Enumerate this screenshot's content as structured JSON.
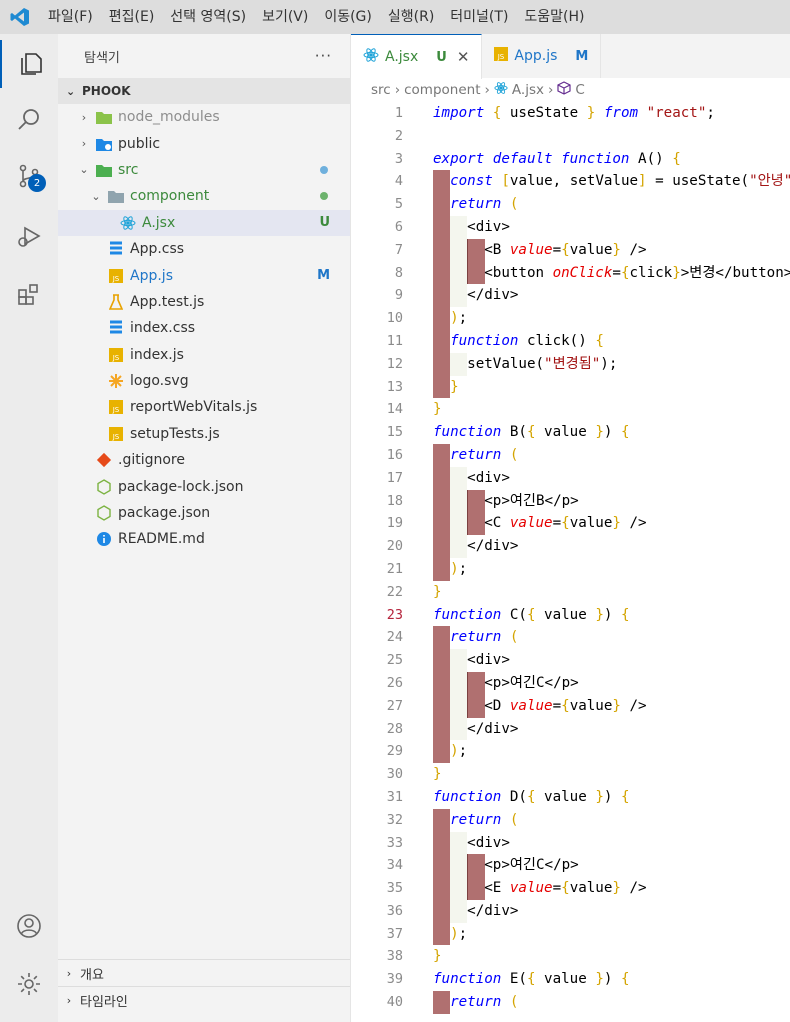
{
  "menu": [
    "파일(F)",
    "편집(E)",
    "선택 영역(S)",
    "보기(V)",
    "이동(G)",
    "실행(R)",
    "터미널(T)",
    "도움말(H)"
  ],
  "sidebar": {
    "title": "탐색기",
    "more": "···",
    "section": "PHOOK",
    "scm_badge": "2",
    "tree": [
      {
        "label": "node_modules",
        "chev": "›",
        "icon": "folder-node",
        "depth": 0,
        "style": "dim"
      },
      {
        "label": "public",
        "chev": "›",
        "icon": "folder-public",
        "depth": 0
      },
      {
        "label": "src",
        "chev": "⌄",
        "icon": "folder-src",
        "depth": 0,
        "style": "new",
        "dot": "#6fb0dd"
      },
      {
        "label": "component",
        "chev": "⌄",
        "icon": "folder-open",
        "depth": 1,
        "style": "new",
        "dot": "#6db36d"
      },
      {
        "label": "A.jsx",
        "icon": "react",
        "depth": 2,
        "style": "new",
        "status": "U",
        "selected": true
      },
      {
        "label": "App.css",
        "icon": "css",
        "depth": 1
      },
      {
        "label": "App.js",
        "icon": "js",
        "depth": 1,
        "style": "mod",
        "status": "M"
      },
      {
        "label": "App.test.js",
        "icon": "test",
        "depth": 1
      },
      {
        "label": "index.css",
        "icon": "css",
        "depth": 1
      },
      {
        "label": "index.js",
        "icon": "js",
        "depth": 1
      },
      {
        "label": "logo.svg",
        "icon": "svg",
        "depth": 1
      },
      {
        "label": "reportWebVitals.js",
        "icon": "js",
        "depth": 1
      },
      {
        "label": "setupTests.js",
        "icon": "js",
        "depth": 1
      },
      {
        "label": ".gitignore",
        "icon": "git",
        "depth": 0
      },
      {
        "label": "package-lock.json",
        "icon": "node",
        "depth": 0
      },
      {
        "label": "package.json",
        "icon": "node",
        "depth": 0
      },
      {
        "label": "README.md",
        "icon": "info",
        "depth": 0
      }
    ],
    "bottom": [
      "개요",
      "타임라인"
    ]
  },
  "tabs": [
    {
      "label": "A.jsx",
      "status": "U",
      "active": true,
      "icon": "react"
    },
    {
      "label": "App.js",
      "status": "M",
      "active": false,
      "icon": "js"
    }
  ],
  "breadcrumbs": [
    "src",
    "component",
    "A.jsx",
    "C"
  ],
  "colors": {
    "accent": "#005fb8",
    "indent_guide": "#b07070",
    "react_icon": "#1fa3d8",
    "js_icon": "#e8b200"
  },
  "code": [
    [
      [
        "k",
        "import"
      ],
      [
        "t",
        " "
      ],
      [
        "br",
        "{"
      ],
      [
        "t",
        " useState "
      ],
      [
        "br",
        "}"
      ],
      [
        "t",
        " "
      ],
      [
        "k",
        "from"
      ],
      [
        "t",
        " "
      ],
      [
        "s",
        "\"react\""
      ],
      [
        "t",
        ";"
      ]
    ],
    [],
    [
      [
        "k",
        "export"
      ],
      [
        "t",
        " "
      ],
      [
        "k",
        "default"
      ],
      [
        "t",
        " "
      ],
      [
        "k",
        "function"
      ],
      [
        "t",
        " A() "
      ],
      [
        "br",
        "{"
      ]
    ],
    [
      [
        "t",
        "  "
      ],
      [
        "k",
        "const"
      ],
      [
        "t",
        " "
      ],
      [
        "br",
        "["
      ],
      [
        "t",
        "value, setValue"
      ],
      [
        "br",
        "]"
      ],
      [
        "t",
        " = useState("
      ],
      [
        "s",
        "\"안녕\""
      ],
      [
        "t",
        ");"
      ]
    ],
    [
      [
        "t",
        "  "
      ],
      [
        "k",
        "return"
      ],
      [
        "t",
        " "
      ],
      [
        "br",
        "("
      ]
    ],
    [
      [
        "t",
        "    <div>"
      ]
    ],
    [
      [
        "t",
        "      <B "
      ],
      [
        "at",
        "value"
      ],
      [
        "t",
        "="
      ],
      [
        "br",
        "{"
      ],
      [
        "t",
        "value"
      ],
      [
        "br",
        "}"
      ],
      [
        "t",
        " />"
      ]
    ],
    [
      [
        "t",
        "      <button "
      ],
      [
        "at",
        "onClick"
      ],
      [
        "t",
        "="
      ],
      [
        "br",
        "{"
      ],
      [
        "t",
        "click"
      ],
      [
        "br",
        "}"
      ],
      [
        "t",
        ">변경</button>"
      ]
    ],
    [
      [
        "t",
        "    </div>"
      ]
    ],
    [
      [
        "t",
        "  "
      ],
      [
        "br",
        ")"
      ],
      [
        "t",
        ";"
      ]
    ],
    [
      [
        "t",
        "  "
      ],
      [
        "k",
        "function"
      ],
      [
        "t",
        " click() "
      ],
      [
        "br",
        "{"
      ]
    ],
    [
      [
        "t",
        "    setValue("
      ],
      [
        "s",
        "\"변경됨\""
      ],
      [
        "t",
        ");"
      ]
    ],
    [
      [
        "t",
        "  "
      ],
      [
        "br",
        "}"
      ]
    ],
    [
      [
        "br",
        "}"
      ]
    ],
    [
      [
        "k",
        "function"
      ],
      [
        "t",
        " B("
      ],
      [
        "br",
        "{"
      ],
      [
        "t",
        " value "
      ],
      [
        "br",
        "}"
      ],
      [
        "t",
        ") "
      ],
      [
        "br",
        "{"
      ]
    ],
    [
      [
        "t",
        "  "
      ],
      [
        "k",
        "return"
      ],
      [
        "t",
        " "
      ],
      [
        "br",
        "("
      ]
    ],
    [
      [
        "t",
        "    <div>"
      ]
    ],
    [
      [
        "t",
        "      <p>여긴B</p>"
      ]
    ],
    [
      [
        "t",
        "      <C "
      ],
      [
        "at",
        "value"
      ],
      [
        "t",
        "="
      ],
      [
        "br",
        "{"
      ],
      [
        "t",
        "value"
      ],
      [
        "br",
        "}"
      ],
      [
        "t",
        " />"
      ]
    ],
    [
      [
        "t",
        "    </div>"
      ]
    ],
    [
      [
        "t",
        "  "
      ],
      [
        "br",
        ")"
      ],
      [
        "t",
        ";"
      ]
    ],
    [
      [
        "br",
        "}"
      ]
    ],
    [
      [
        "k",
        "function"
      ],
      [
        "t",
        " C("
      ],
      [
        "br",
        "{"
      ],
      [
        "t",
        " value "
      ],
      [
        "br",
        "}"
      ],
      [
        "t",
        ") "
      ],
      [
        "br",
        "{"
      ]
    ],
    [
      [
        "t",
        "  "
      ],
      [
        "k",
        "return"
      ],
      [
        "t",
        " "
      ],
      [
        "br",
        "("
      ]
    ],
    [
      [
        "t",
        "    <div>"
      ]
    ],
    [
      [
        "t",
        "      <p>여긴C</p>"
      ]
    ],
    [
      [
        "t",
        "      <D "
      ],
      [
        "at",
        "value"
      ],
      [
        "t",
        "="
      ],
      [
        "br",
        "{"
      ],
      [
        "t",
        "value"
      ],
      [
        "br",
        "}"
      ],
      [
        "t",
        " />"
      ]
    ],
    [
      [
        "t",
        "    </div>"
      ]
    ],
    [
      [
        "t",
        "  "
      ],
      [
        "br",
        ")"
      ],
      [
        "t",
        ";"
      ]
    ],
    [
      [
        "br",
        "}"
      ]
    ],
    [
      [
        "k",
        "function"
      ],
      [
        "t",
        " D("
      ],
      [
        "br",
        "{"
      ],
      [
        "t",
        " value "
      ],
      [
        "br",
        "}"
      ],
      [
        "t",
        ") "
      ],
      [
        "br",
        "{"
      ]
    ],
    [
      [
        "t",
        "  "
      ],
      [
        "k",
        "return"
      ],
      [
        "t",
        " "
      ],
      [
        "br",
        "("
      ]
    ],
    [
      [
        "t",
        "    <div>"
      ]
    ],
    [
      [
        "t",
        "      <p>여긴C</p>"
      ]
    ],
    [
      [
        "t",
        "      <E "
      ],
      [
        "at",
        "value"
      ],
      [
        "t",
        "="
      ],
      [
        "br",
        "{"
      ],
      [
        "t",
        "value"
      ],
      [
        "br",
        "}"
      ],
      [
        "t",
        " />"
      ]
    ],
    [
      [
        "t",
        "    </div>"
      ]
    ],
    [
      [
        "t",
        "  "
      ],
      [
        "br",
        ")"
      ],
      [
        "t",
        ";"
      ]
    ],
    [
      [
        "br",
        "}"
      ]
    ],
    [
      [
        "k",
        "function"
      ],
      [
        "t",
        " E("
      ],
      [
        "br",
        "{"
      ],
      [
        "t",
        " value "
      ],
      [
        "br",
        "}"
      ],
      [
        "t",
        ") "
      ],
      [
        "br",
        "{"
      ]
    ],
    [
      [
        "t",
        "  "
      ],
      [
        "k",
        "return"
      ],
      [
        "t",
        " "
      ],
      [
        "br",
        "("
      ]
    ]
  ],
  "current_line": 23
}
